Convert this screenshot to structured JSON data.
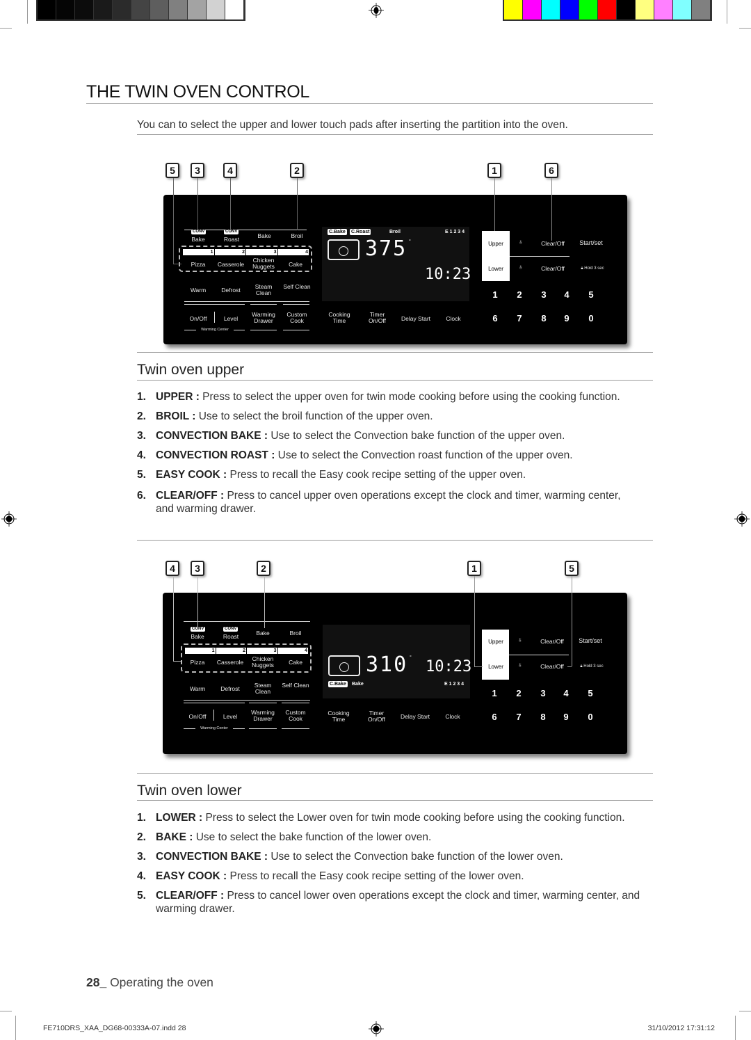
{
  "registration": {
    "gray_swatches": [
      "#000000",
      "#050505",
      "#0c0c0c",
      "#1a1a1a",
      "#2b2b2b",
      "#444444",
      "#5e5e5e",
      "#808080",
      "#a3a3a3",
      "#d2d2d2",
      "#ffffff"
    ],
    "color_swatches": [
      "#ffff00",
      "#ff00ff",
      "#00ffff",
      "#0000ff",
      "#00ff00",
      "#ff0000",
      "#000000",
      "#ffff80",
      "#ff80ff",
      "#80ffff",
      "#808080"
    ]
  },
  "page": {
    "title": "THE TWIN OVEN CONTROL",
    "intro": "You can to select the upper and lower touch pads after inserting the partition into the oven."
  },
  "panel_labels": {
    "conv": "CONV",
    "conv_bake": "Bake",
    "conv_roast": "Roast",
    "bake": "Bake",
    "broil": "Broil",
    "easy_nums": [
      "1",
      "2",
      "3",
      "4"
    ],
    "pizza": "Pizza",
    "casserole": "Casserole",
    "chicken_nuggets": "Chicken Nuggets",
    "cake": "Cake",
    "warm": "Warm",
    "defrost": "Defrost",
    "steam_clean": "Steam Clean",
    "self_clean": "Self Clean",
    "on_off": "On/Off",
    "level": "Level",
    "warming_drawer": "Warming Drawer",
    "custom_cook": "Custom Cook",
    "warming_center": "Warming Center",
    "cooking_time": "Cooking Time",
    "timer_on_off": "Timer On/Off",
    "delay_start": "Delay Start",
    "clock": "Clock",
    "upper": "Upper",
    "lower": "Lower",
    "clear_off": "Clear/Off",
    "start_set": "Start/set",
    "hold_3_sec": "Hold 3 sec",
    "keys_row1": [
      "1",
      "2",
      "3",
      "4",
      "5"
    ],
    "keys_row2": [
      "6",
      "7",
      "8",
      "9",
      "0"
    ],
    "degree": "°",
    "easy_indicator": "E 1 2 3 4"
  },
  "upper_panel": {
    "callouts": [
      "5",
      "3",
      "4",
      "2",
      "1",
      "6"
    ],
    "display": {
      "tags": [
        "C.Bake",
        "C.Roast"
      ],
      "mode_text": "Broil",
      "temperature": "375",
      "clock": "10:23"
    }
  },
  "lower_panel": {
    "callouts": [
      "4",
      "3",
      "2",
      "1",
      "5"
    ],
    "display": {
      "tags": [
        "C.Bake"
      ],
      "mode_text": "Bake",
      "temperature": "310",
      "clock": "10:23"
    }
  },
  "upper_section": {
    "title": "Twin oven upper",
    "items": [
      {
        "num": "1.",
        "term": "UPPER :",
        "text": " Press to select the upper oven for twin mode cooking before using the cooking function."
      },
      {
        "num": "2.",
        "term": "BROIL :",
        "text": " Use to select the broil function of the upper oven."
      },
      {
        "num": "3.",
        "term": "CONVECTION BAKE :",
        "text": " Use to select the Convection bake function of the upper oven."
      },
      {
        "num": "4.",
        "term": "CONVECTION ROAST :",
        "text": " Use to select the Convection roast function of the upper oven."
      },
      {
        "num": "5.",
        "term": "EASY COOK :",
        "text": " Press to recall the Easy cook recipe setting of the upper oven."
      },
      {
        "num": "6.",
        "term": "CLEAR/OFF :",
        "text": " Press to cancel upper oven operations except the clock and timer, warming center, and warming drawer."
      }
    ]
  },
  "lower_section": {
    "title": "Twin oven lower",
    "items": [
      {
        "num": "1.",
        "term": "LOWER :",
        "text": " Press to select the Lower oven for twin mode cooking before using the cooking function."
      },
      {
        "num": "2.",
        "term": "BAKE :",
        "text": " Use to select the bake function of the lower oven."
      },
      {
        "num": "3.",
        "term": "CONVECTION BAKE :",
        "text": " Use to select the Convection bake function of the lower oven."
      },
      {
        "num": "4.",
        "term": "EASY COOK :",
        "text": " Press to recall the Easy cook recipe setting of the lower oven."
      },
      {
        "num": "5.",
        "term": "CLEAR/OFF :",
        "text": " Press to cancel lower oven operations except the clock and timer, warming center, and warming drawer."
      }
    ]
  },
  "footer": {
    "page_number": "28_",
    "section": " Operating the oven",
    "file_slug": "FE710DRS_XAA_DG68-00333A-07.indd   28",
    "timestamp": "31/10/2012   17:31:12"
  }
}
